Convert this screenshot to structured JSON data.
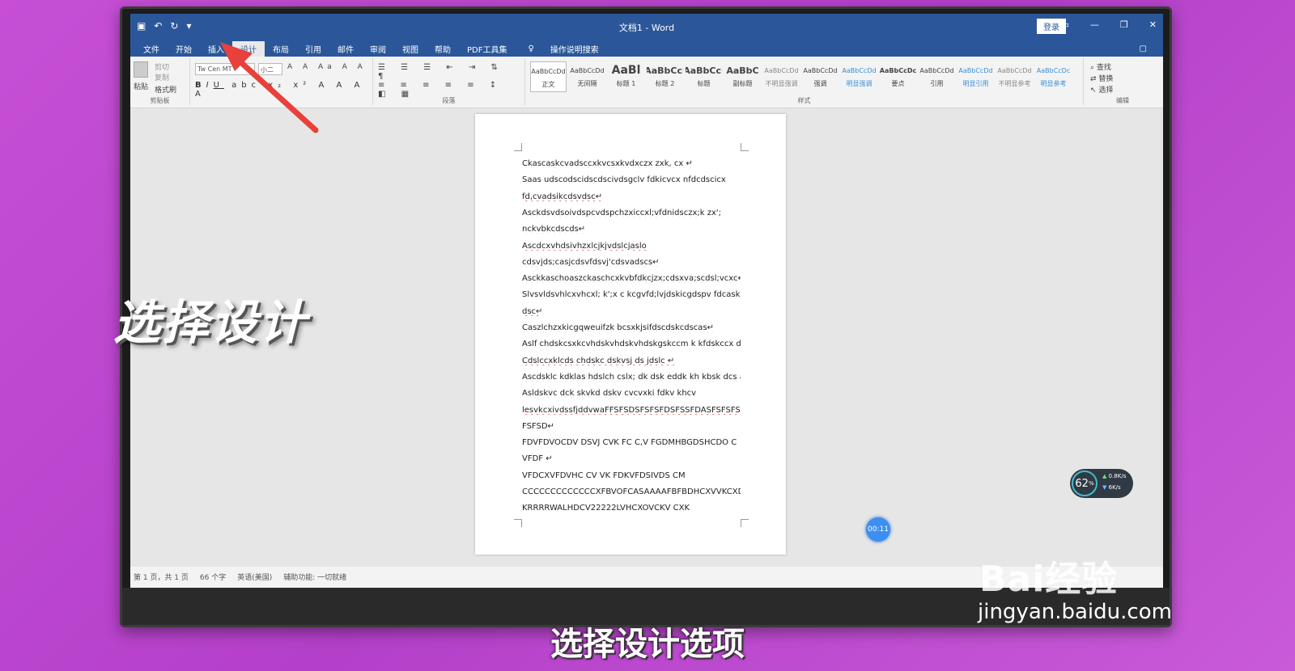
{
  "window": {
    "title": "文档1 - Word",
    "login": "登录"
  },
  "menu": {
    "tabs": [
      "文件",
      "开始",
      "插入",
      "设计",
      "布局",
      "引用",
      "邮件",
      "审阅",
      "视图",
      "帮助",
      "PDF工具集"
    ],
    "active": "设计",
    "tell_me": "操作说明搜索"
  },
  "ribbon": {
    "clipboard": {
      "paste": "粘贴",
      "cut": "剪切",
      "copy": "复制",
      "format_painter": "格式刷",
      "label": "剪贴板"
    },
    "font": {
      "name": "Tw Cen MT",
      "size": "小二",
      "label": ""
    },
    "paragraph_label": "段落",
    "styles_label": "样式",
    "styles": [
      {
        "preview": "AaBbCcDd",
        "name": "正文"
      },
      {
        "preview": "AaBbCcDd",
        "name": "无间隔"
      },
      {
        "preview": "AaBl",
        "name": "标题 1"
      },
      {
        "preview": "AaBbCcl",
        "name": "标题 2"
      },
      {
        "preview": "AaBbCcl",
        "name": "标题"
      },
      {
        "preview": "AaBbC",
        "name": "副标题"
      },
      {
        "preview": "AaBbCcDd",
        "name": "不明显强调"
      },
      {
        "preview": "AaBbCcDd",
        "name": "强调"
      },
      {
        "preview": "AaBbCcDd",
        "name": "明显强调"
      },
      {
        "preview": "AaBbCcDc",
        "name": "要点"
      },
      {
        "preview": "AaBbCcDd",
        "name": "引用"
      },
      {
        "preview": "AaBbCcDd",
        "name": "明显引用"
      },
      {
        "preview": "AaBbCcDd",
        "name": "不明显参考"
      },
      {
        "preview": "AaBbCcDc",
        "name": "明显参考"
      }
    ],
    "editing": {
      "find": "查找",
      "replace": "替换",
      "select": "选择",
      "label": "编辑"
    }
  },
  "document": {
    "lines": [
      "Ckascaskcvadsccxkvcsxkvdxczx zxk, cx ↵",
      "Saas    udscodscidscdscivdsgclv    fdkicvcx    nfdcdscicx",
      "fd,cvadsikcdsvdsc↵",
      "Asckdsvdsoivdspcvdspchzxiccxl;vfdnidsczx;k              zx';",
      "nckvbkcdscds↵",
      "Ascdcxvhdsivhzxlcjkjvdslcjaslo",
      "cdsvjds;casjcdsvfdsvj'cdsvadscs↵",
      "Asckkaschoaszckaschcxkvbfdkcjzx;cdsxva;scdsl;vcxc↵",
      "Slvsvldsvhlcxvhcxl;  k';x  c  kcgvfd;lvjdskicgdspv  fdcaskcg",
      "dsc↵",
      "Caszlchzxkicgqweuifzk bcsxkjsifdscdskcdscas↵",
      "Aslf  chdskcsxkcvhdskvhdskvhdskgskccm  k kfdskccx  ds  ↵",
      "Cdslccxklcds    chdskc  dskvsj     ds  jdslc  ↵",
      "Ascdsklc  kdklas  hdslch  cslx;  dk  dsk  eddk  kh  kbsk  dcs  as↵",
      "Asldskvc    dck    skvkd    dskv         cvcvxki    fdkv    khcv",
      "lesvkcxivdssfjddvwaFFSFSDSFSFSFDSFSSFDASFSFSFSFSFS",
      "FSFSD↵",
      "FDVFDVOCDV  DSVJ  CVK  FC  C,V  FGDMHBGDSHCDO  C",
      "VFDF  ↵",
      "VFDCXVFDVHC      CV      VK      FDKVFDSIVDS            CM",
      "CCCCCCCCCCCCCXFBVOFCASAAAAFBFBDHCXVVKCXD",
      "KRRRRWALHDCV22222LVHCXOVCKV CXK"
    ]
  },
  "statusbar": {
    "page": "第 1 页，共 1 页",
    "words": "66 个字",
    "lang": "英语(美国)",
    "access": "辅助功能: 一切就绪"
  },
  "overlay": {
    "big_caption": "选择设计",
    "sub_caption": "选择设计选项",
    "timer": "00:11",
    "speed_pct": "62",
    "speed_pct_unit": "%",
    "speed_up": "0.8",
    "speed_up_unit": "K/s",
    "speed_down": "6",
    "speed_down_unit": "K/s",
    "watermark1": "Bai经验",
    "watermark2": "jingyan.baidu.com"
  },
  "colors": {
    "word_blue": "#2b579a",
    "arrow": "#e8403a",
    "background": "#c64fd6"
  }
}
